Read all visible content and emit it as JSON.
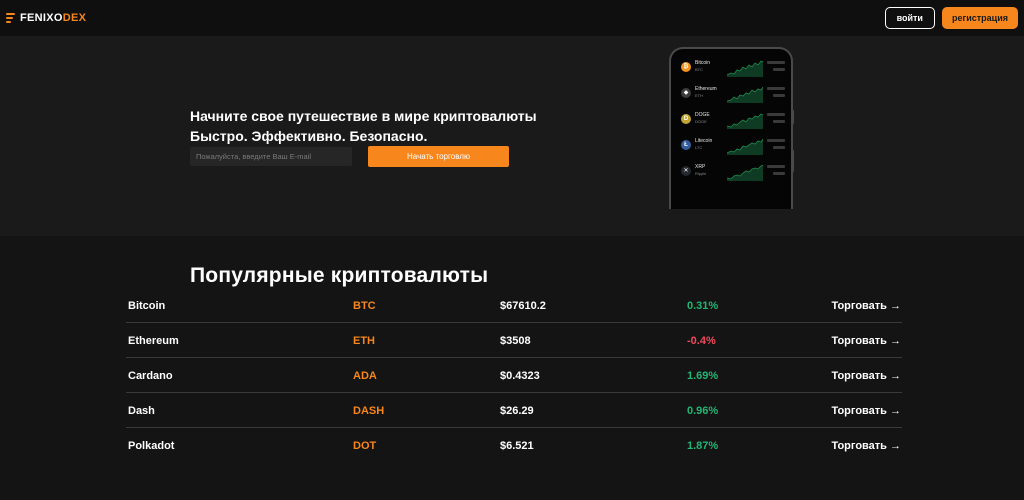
{
  "header": {
    "logo_part1": "FENIXO",
    "logo_part2": "DEX",
    "login_label": "войти",
    "register_label": "регистрация",
    "brand_color": "#f7861c"
  },
  "hero": {
    "title_line1": "Начните свое путешествие в мире криптовалюты",
    "title_line2": "Быстро. Эффективно. Безопасно.",
    "email_placeholder": "Пожалуйста, введите Ваш E-mail",
    "start_button": "Начать торговлю"
  },
  "phone": {
    "coins": [
      {
        "name": "Bitcoin",
        "ticker": "BTC",
        "icon": "bitcoin-icon",
        "glyph": "₿",
        "color": "#f7931a"
      },
      {
        "name": "Ethereum",
        "ticker": "ETH",
        "icon": "ethereum-icon",
        "glyph": "◆",
        "color": "#3c3c3d"
      },
      {
        "name": "DOGE",
        "ticker": "DOGE",
        "icon": "doge-icon",
        "glyph": "D",
        "color": "#c2a633"
      },
      {
        "name": "Litecoin",
        "ticker": "LTC",
        "icon": "litecoin-icon",
        "glyph": "Ł",
        "color": "#345d9d"
      },
      {
        "name": "XRP",
        "ticker": "Ripple",
        "icon": "xrp-icon",
        "glyph": "✕",
        "color": "#23292f"
      }
    ]
  },
  "popular": {
    "title": "Популярные криптовалюты",
    "rows": [
      {
        "name": "Bitcoin",
        "symbol": "BTC",
        "price": "$67610.2",
        "change": "0.31%",
        "direction": "up",
        "action": "Торговать →"
      },
      {
        "name": "Ethereum",
        "symbol": "ETH",
        "price": "$3508",
        "change": "-0.4%",
        "direction": "down",
        "action": "Торговать →"
      },
      {
        "name": "Cardano",
        "symbol": "ADA",
        "price": "$0.4323",
        "change": "1.69%",
        "direction": "up",
        "action": "Торговать →"
      },
      {
        "name": "Dash",
        "symbol": "DASH",
        "price": "$26.29",
        "change": "0.96%",
        "direction": "up",
        "action": "Торговать →"
      },
      {
        "name": "Polkadot",
        "symbol": "DOT",
        "price": "$6.521",
        "change": "1.87%",
        "direction": "up",
        "action": "Торговать →"
      }
    ]
  }
}
